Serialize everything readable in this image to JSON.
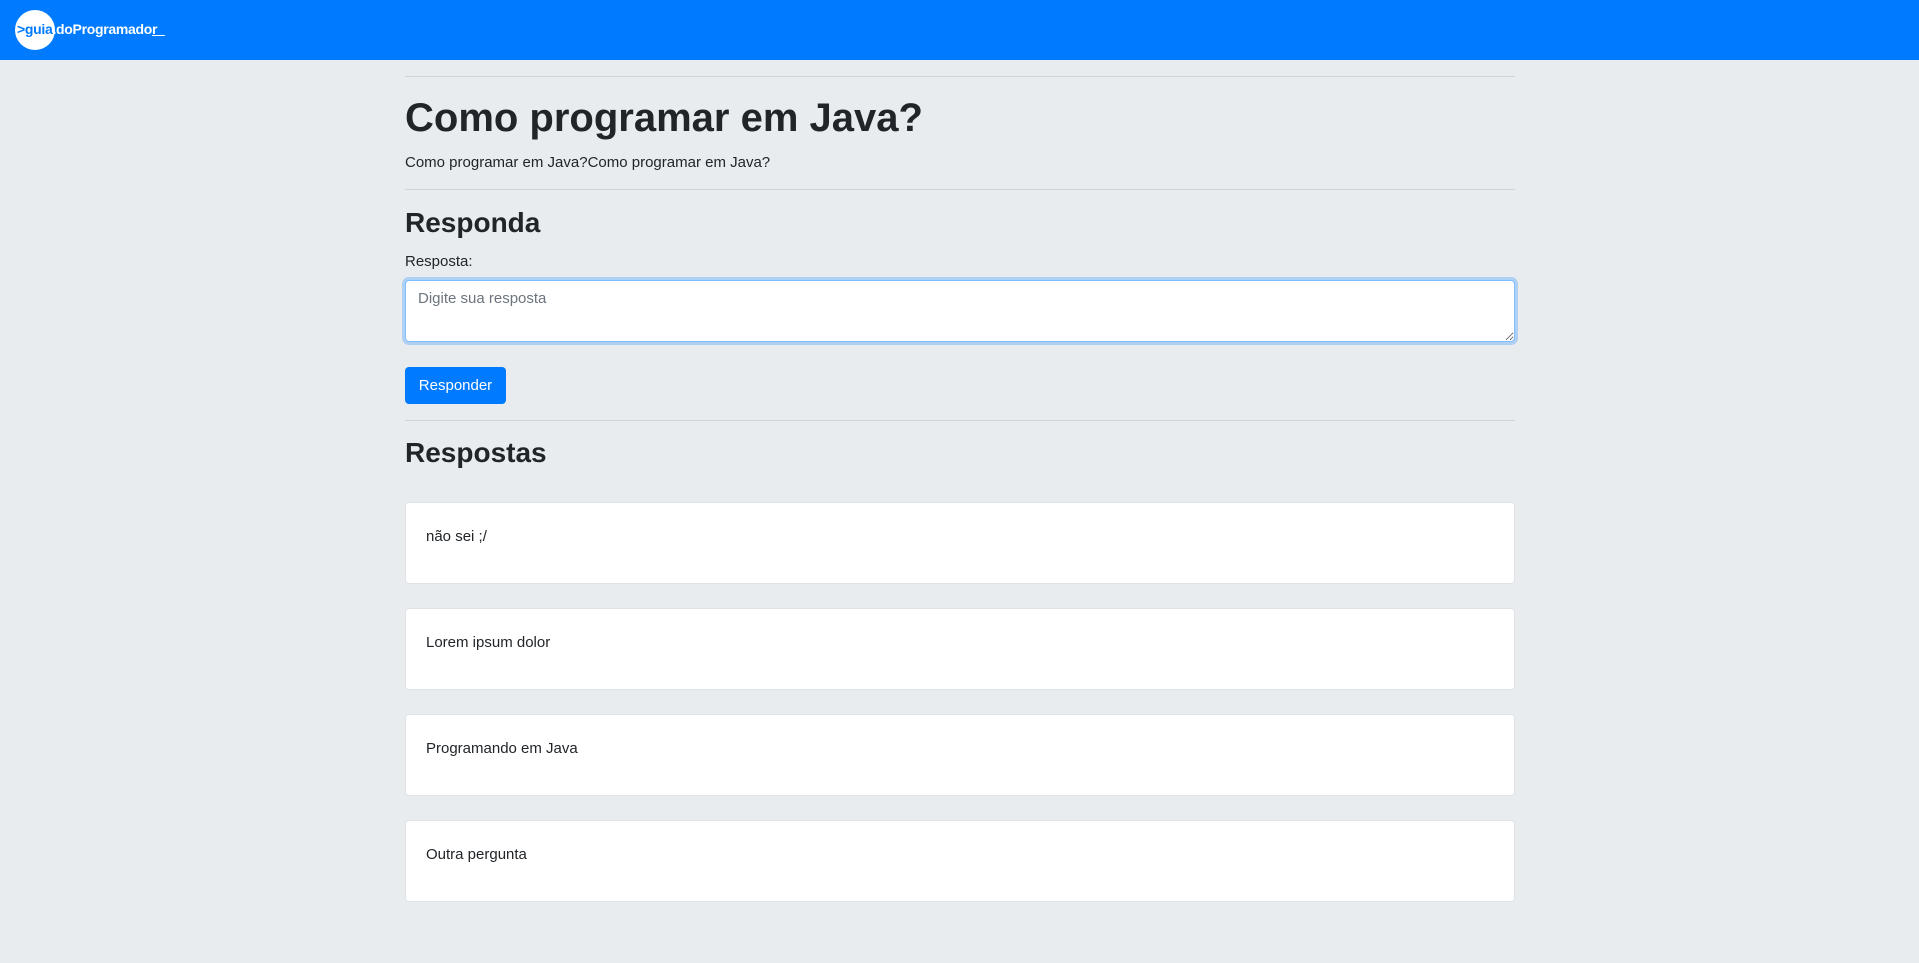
{
  "navbar": {
    "brand_prefix": ">guia",
    "brand_middle": ".doProgramado",
    "brand_suffix": "r_"
  },
  "question": {
    "title": "Como programar em Java?",
    "description": "Como programar em Java?Como programar em Java?"
  },
  "answer_form": {
    "heading": "Responda",
    "label": "Resposta:",
    "placeholder": "Digite sua resposta",
    "submit_label": "Responder"
  },
  "answers": {
    "heading": "Respostas",
    "items": [
      "não sei ;/",
      "Lorem ipsum dolor",
      "Programando em Java",
      "Outra pergunta"
    ]
  },
  "colors": {
    "primary": "#007bff",
    "background": "#e9ecef"
  }
}
